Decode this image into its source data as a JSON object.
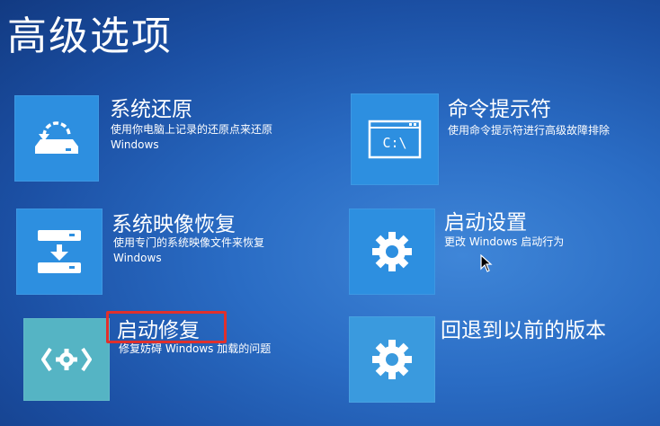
{
  "page": {
    "title": "高级选项"
  },
  "options": [
    {
      "id": "system-restore",
      "title": "系统还原",
      "desc1": "使用你电脑上记录的还原点来还原",
      "desc2": "Windows",
      "icon": "system-restore-icon"
    },
    {
      "id": "command-prompt",
      "title": "命令提示符",
      "desc1": "使用命令提示符进行高级故障排除",
      "desc2": "",
      "icon": "command-prompt-icon"
    },
    {
      "id": "system-image-recovery",
      "title": "系统映像恢复",
      "desc1": "使用专门的系统映像文件来恢复",
      "desc2": "Windows",
      "icon": "system-image-icon"
    },
    {
      "id": "startup-settings",
      "title": "启动设置",
      "desc1": "更改 Windows 启动行为",
      "desc2": "",
      "icon": "gear-icon"
    },
    {
      "id": "startup-repair",
      "title": "启动修复",
      "desc1": "修复妨碍 Windows 加载的问题",
      "desc2": "",
      "icon": "repair-code-icon"
    },
    {
      "id": "go-back",
      "title": "回退到以前的版本",
      "desc1": "",
      "desc2": "",
      "icon": "gear-icon"
    }
  ],
  "icons": {
    "command_prompt_text": "C:\\"
  },
  "colors": {
    "tile_bg": "#2d8fe0",
    "highlight": "#e0302c",
    "background": "#1b4fa3"
  }
}
